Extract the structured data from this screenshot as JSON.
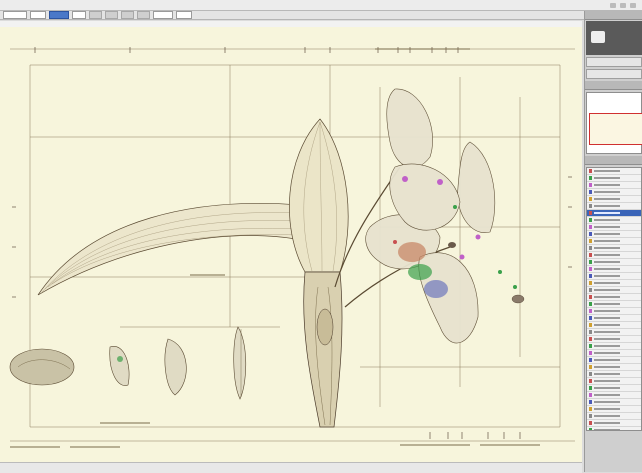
{
  "menubar": {
    "items": [
      "",
      "",
      "",
      "",
      "",
      "",
      ""
    ]
  },
  "toolbar": {
    "fields": [
      "",
      "",
      "",
      "",
      "",
      ""
    ]
  },
  "canvas": {
    "background": "#f7f5dc",
    "accent_magenta": "#c060c8",
    "accent_green": "#3aa04a",
    "accent_red": "#c85050",
    "accent_blue": "#4a5ab8",
    "line_color": "#6a5a3a"
  },
  "panel": {
    "navigator_frame_color": "#d03030",
    "selected_layer_color": "#3a64b8",
    "layer_count": 40,
    "selected_layer_index": 6
  },
  "icons": [
    "minimize-icon",
    "maximize-icon",
    "close-icon"
  ]
}
